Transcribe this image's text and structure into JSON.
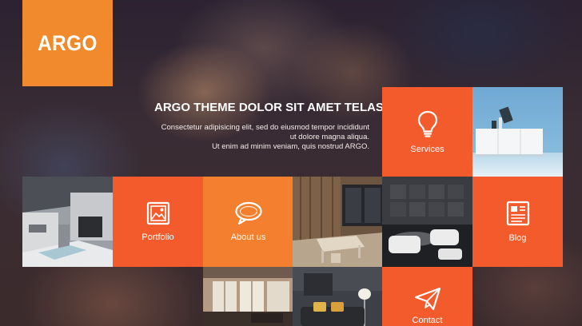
{
  "brand": {
    "logo_text": "ARGO",
    "accent": "#f08a2c"
  },
  "hero": {
    "headline": "ARGO THEME DOLOR SIT AMET TELASDE",
    "lines": [
      "Consectetur adipisicing elit, sed do eiusmod tempor incididunt",
      "ut dolore magna aliqua.",
      "Ut enim ad minim veniam, quis nostrud ARGO."
    ]
  },
  "tiles": {
    "services": {
      "label": "Services",
      "icon": "lightbulb-icon"
    },
    "portfolio": {
      "label": "Portfolio",
      "icon": "image-icon"
    },
    "about": {
      "label": "About us",
      "icon": "speech-bubble-icon"
    },
    "blog": {
      "label": "Blog",
      "icon": "newspaper-icon"
    },
    "contact": {
      "label": "Contact",
      "icon": "paper-plane-icon"
    }
  },
  "colors": {
    "tile_red": "#f35b2d",
    "tile_orange": "#f4802f"
  }
}
